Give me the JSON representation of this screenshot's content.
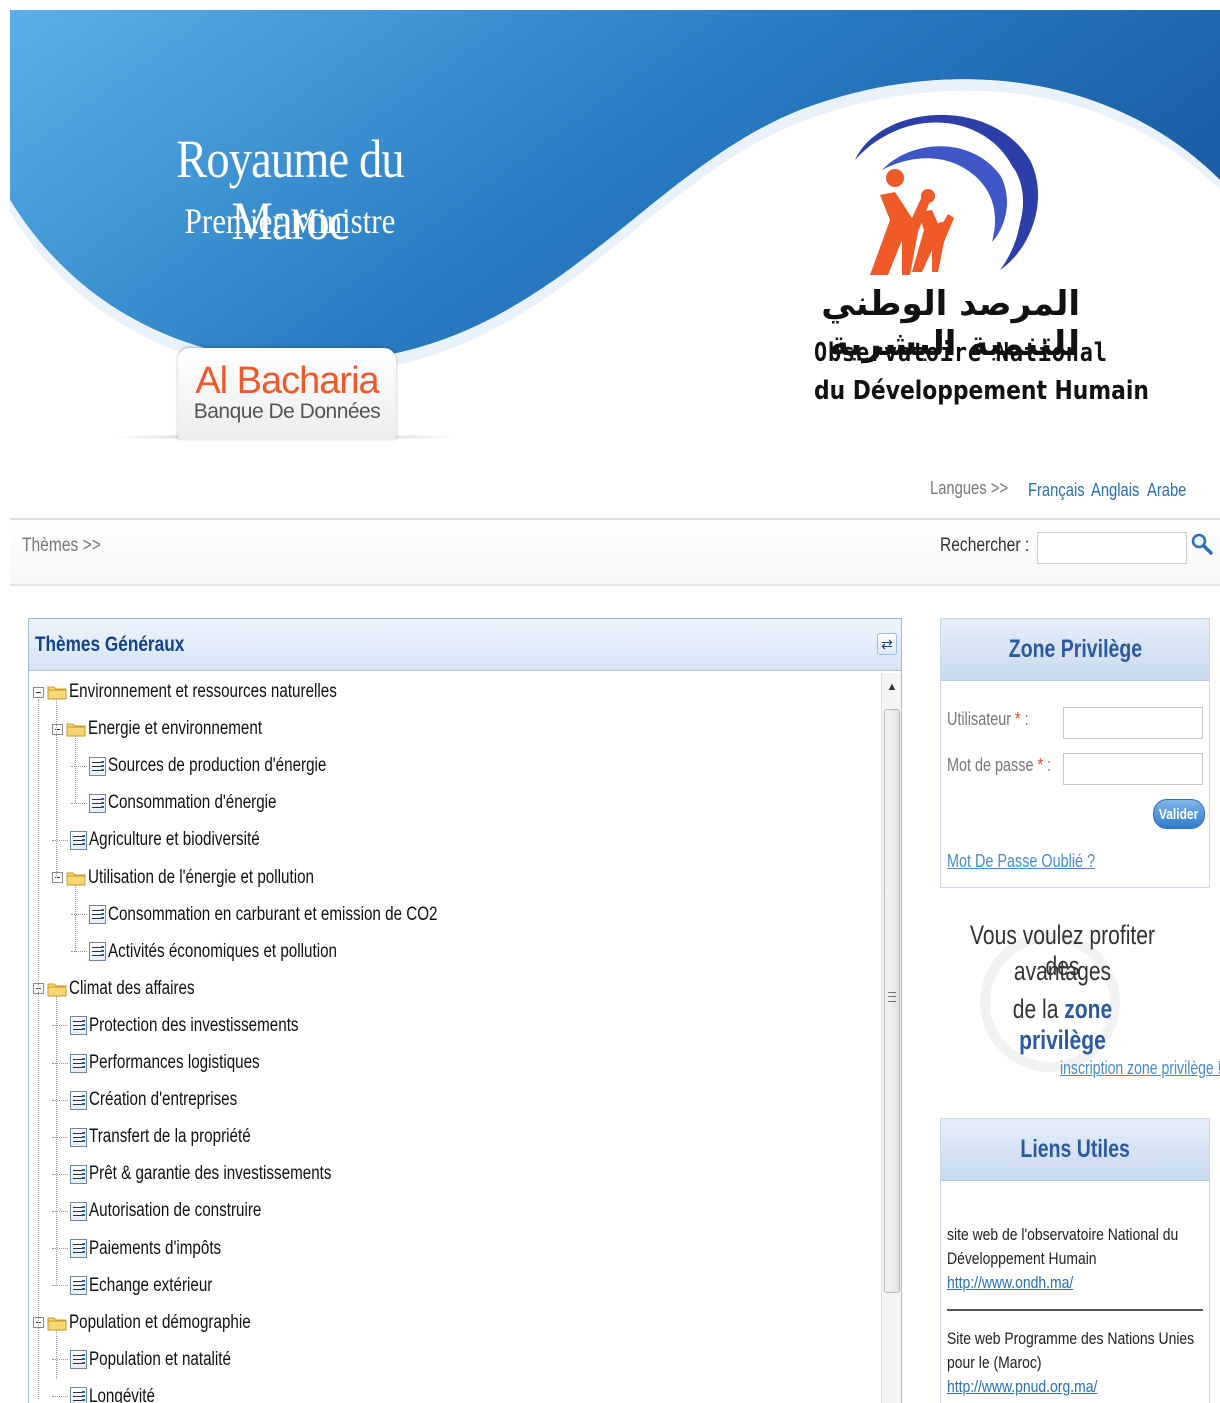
{
  "header": {
    "royaume": "Royaume du Maroc",
    "ministre": "Premier Ministre",
    "logo_name": "Al Bacharia",
    "logo_sub": "Banque De Données",
    "ondh_arabic": "المرصد الوطني للتنمية البشرية",
    "ondh_line1": "Observatoire National",
    "ondh_line2": "du Développement Humain",
    "colors": {
      "banner_blue": "#2a7ec4",
      "banner_light": "#5ab0e6",
      "logo_orange": "#f05a28",
      "arc_blue": "#2e3ea8"
    }
  },
  "languages": {
    "label": "Langues >>",
    "items": [
      "Français",
      "Anglais",
      "Arabe"
    ]
  },
  "themebar": {
    "themes_label": "Thèmes >>",
    "search_label": "Rechercher :",
    "search_value": "",
    "search_icon": "search-icon"
  },
  "tree": {
    "title": "Thèmes Généraux",
    "nodes": [
      {
        "label": "Environnement et ressources naturelles",
        "level": 0,
        "type": "folder"
      },
      {
        "label": "Energie et environnement",
        "level": 1,
        "type": "folder"
      },
      {
        "label": "Sources de production d'énergie",
        "level": 2,
        "type": "doc"
      },
      {
        "label": "Consommation d'énergie",
        "level": 2,
        "type": "doc"
      },
      {
        "label": "Agriculture et biodiversité",
        "level": 1,
        "type": "doc"
      },
      {
        "label": "Utilisation de l'énergie et pollution",
        "level": 1,
        "type": "folder"
      },
      {
        "label": "Consommation en carburant et emission de CO2",
        "level": 2,
        "type": "doc"
      },
      {
        "label": "Activités économiques et pollution",
        "level": 2,
        "type": "doc"
      },
      {
        "label": "Climat des affaires",
        "level": 0,
        "type": "folder"
      },
      {
        "label": "Protection des investissements",
        "level": 1,
        "type": "doc"
      },
      {
        "label": "Performances logistiques",
        "level": 1,
        "type": "doc"
      },
      {
        "label": "Création d'entreprises",
        "level": 1,
        "type": "doc"
      },
      {
        "label": "Transfert de la propriété",
        "level": 1,
        "type": "doc"
      },
      {
        "label": "Prêt & garantie des investissements",
        "level": 1,
        "type": "doc"
      },
      {
        "label": "Autorisation de construire",
        "level": 1,
        "type": "doc"
      },
      {
        "label": "Paiements d'impôts",
        "level": 1,
        "type": "doc"
      },
      {
        "label": "Echange extérieur",
        "level": 1,
        "type": "doc"
      },
      {
        "label": "Population et démographie",
        "level": 0,
        "type": "folder"
      },
      {
        "label": "Population et natalité",
        "level": 1,
        "type": "doc"
      },
      {
        "label": "Longévité",
        "level": 1,
        "type": "doc"
      }
    ]
  },
  "zone_privilege": {
    "title": "Zone Privilège",
    "user_label": "Utilisateur",
    "pass_label": "Mot de passe",
    "required_mark": "*",
    "colon": ":",
    "user_value": "",
    "pass_value": "",
    "submit": "Valider",
    "forgot": "Mot De Passe Oublié ?"
  },
  "promo": {
    "line1": "Vous voulez profiter des",
    "line2": "avantages",
    "line3_prefix": "de la",
    "line3_strong": "zone privilège",
    "link": "inscription zone privilège !"
  },
  "liens": {
    "title": "Liens Utiles",
    "items": [
      {
        "text1": "site web de l'observatoire National du",
        "text2": "Développement Humain",
        "url": "http://www.ondh.ma/"
      },
      {
        "text1": "Site web Programme des Nations Unies",
        "text2": "pour le (Maroc)",
        "url": "http://www.pnud.org.ma/"
      }
    ]
  }
}
